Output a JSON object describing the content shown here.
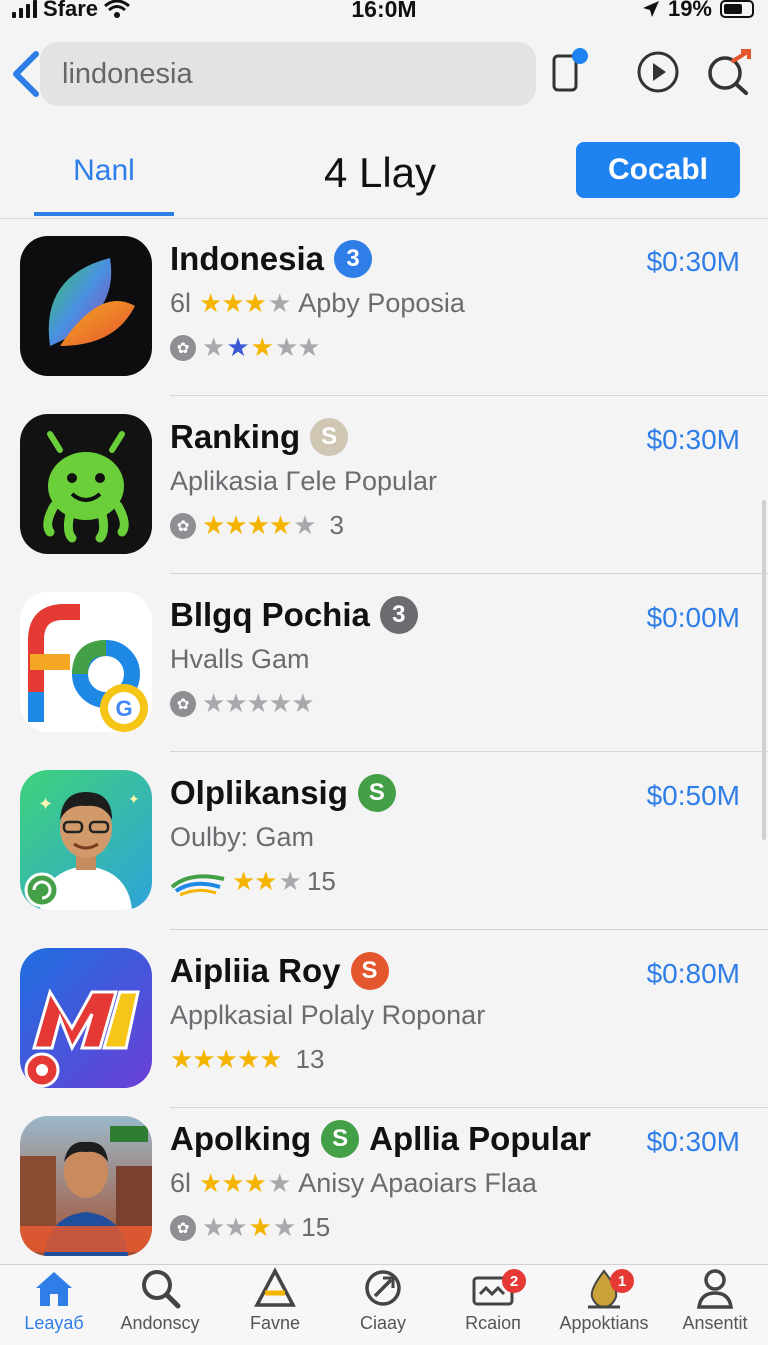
{
  "status_bar": {
    "carrier": "Sfare",
    "time": "16:0M",
    "battery": "19%"
  },
  "search": {
    "query": "lindonesia"
  },
  "tabs": {
    "first": "Nanl",
    "title": "4 Llay",
    "button": "Cocabl"
  },
  "apps": [
    {
      "name": "Indonesia",
      "badge": "3",
      "badge_color": "#2f7ee8",
      "price": "$0:30M",
      "prefix": "6l",
      "subtitle": "Apby Poposia",
      "rating_count": ""
    },
    {
      "name": "Ranking",
      "badge": "S",
      "badge_color": "#cfc7b3",
      "price": "$0:30M",
      "prefix": "",
      "subtitle": "Aplikasia Γele Popular",
      "rating_count": "3"
    },
    {
      "name": "Bllgq Pochia",
      "badge": "3",
      "badge_color": "#6b6b70",
      "price": "$0:00M",
      "prefix": "",
      "subtitle": "Ηvalls Gam",
      "rating_count": ""
    },
    {
      "name": "Olplikansig",
      "badge": "S",
      "badge_color": "#43a047",
      "price": "$0:50M",
      "prefix": "",
      "subtitle": "Oulby: Gam",
      "rating_count": "15"
    },
    {
      "name": "Aipliia Roy",
      "badge": "S",
      "badge_color": "#e4572e",
      "price": "$0:80M",
      "prefix": "",
      "subtitle": "Applkasial Polaly Roponar",
      "rating_count": "13"
    },
    {
      "name": "Apolking",
      "badge": "S",
      "badge_color": "#43a047",
      "name_suffix": "Apllia Popular",
      "price": "$0:30M",
      "prefix": "6l",
      "subtitle": "Anisy Apaoiars Flaa",
      "rating_count": "15"
    }
  ],
  "bottom_nav": [
    {
      "label": "Leayaб",
      "icon": "home-icon"
    },
    {
      "label": "Andonscy",
      "icon": "search-icon"
    },
    {
      "label": "Favne",
      "icon": "triangle-icon"
    },
    {
      "label": "Ciaay",
      "icon": "refresh-icon"
    },
    {
      "label": "Rcaioп",
      "icon": "inbox-icon",
      "badge": "2"
    },
    {
      "label": "Appoktians",
      "icon": "drop-icon",
      "badge": "1"
    },
    {
      "label": "Ansentit",
      "icon": "person-icon"
    }
  ],
  "colors": {
    "accent": "#2f7ee8",
    "button": "#1e83f0",
    "star": "#f5b400"
  }
}
